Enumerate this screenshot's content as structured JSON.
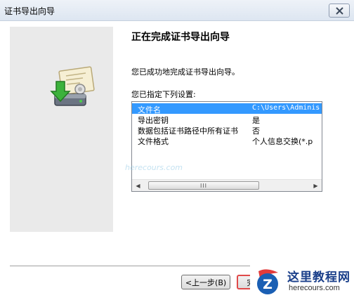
{
  "window": {
    "title": "证书导出向导"
  },
  "wizard": {
    "heading": "正在完成证书导出向导",
    "message": "您已成功地完成证书导出向导。",
    "spec_label": "您已指定下列设置:",
    "settings": [
      {
        "key": "文件名",
        "value": "C:\\Users\\Adminis"
      },
      {
        "key": "导出密钥",
        "value": "是"
      },
      {
        "key": "数据包括证书路径中所有证书",
        "value": "否"
      },
      {
        "key": "文件格式",
        "value": "个人信息交换(*.p"
      }
    ],
    "scroll_left": "◀",
    "scroll_right": "▶",
    "scroll_grip": "III"
  },
  "watermark": "herecours.com",
  "buttons": {
    "back": "<上一步(B)",
    "finish": "完"
  },
  "logo": {
    "name": "这里教程网",
    "url": "herecours.com",
    "mark_letter": "Z"
  }
}
